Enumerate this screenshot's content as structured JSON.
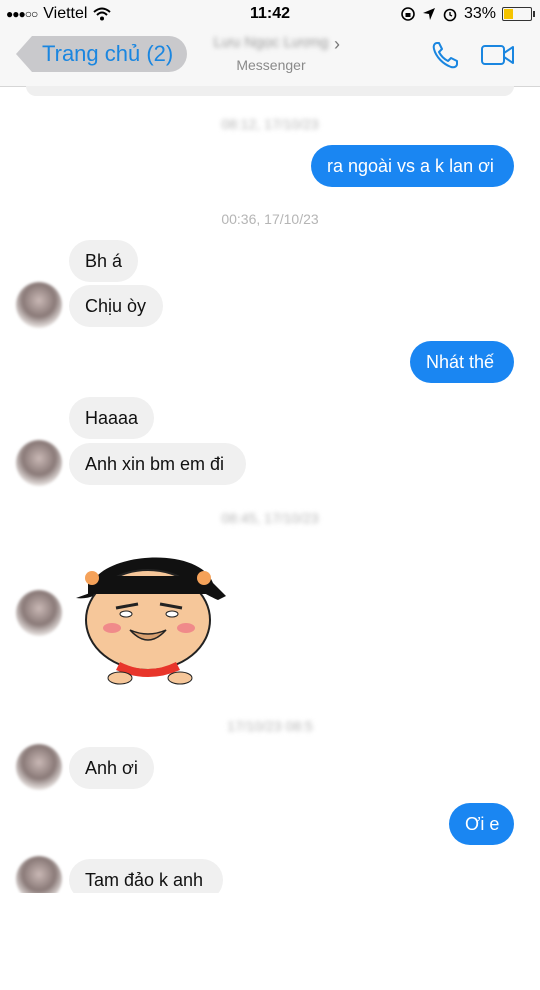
{
  "status_bar": {
    "carrier": "Viettel",
    "time": "11:42",
    "battery_percent": "33%",
    "battery_level": 0.33
  },
  "nav": {
    "back_label": "Trang chủ (2)",
    "contact_name": "Lưu Ngọc Lương",
    "subtitle": "Messenger"
  },
  "timestamps": [
    "08:12, 17/10/23",
    "00:36, 17/10/23",
    "08:45, 17/10/23",
    "17/10/23 08:5"
  ],
  "messages": [
    {
      "text": "ra ngoài vs a k lan ơi"
    },
    {
      "text": "Bh á"
    },
    {
      "text": "Chịu òy"
    },
    {
      "text": "Nhát thế"
    },
    {
      "text": "Haaaa"
    },
    {
      "text": "Anh xin bm em đi"
    },
    {
      "text": "Anh ơi"
    },
    {
      "text": "Ơi e"
    },
    {
      "text": "Tam đảo k anh"
    }
  ],
  "icons": [
    "wifi-icon",
    "lock-rotation-icon",
    "location-icon",
    "alarm-icon",
    "phone-icon",
    "video-icon",
    "chevron-right-icon"
  ]
}
